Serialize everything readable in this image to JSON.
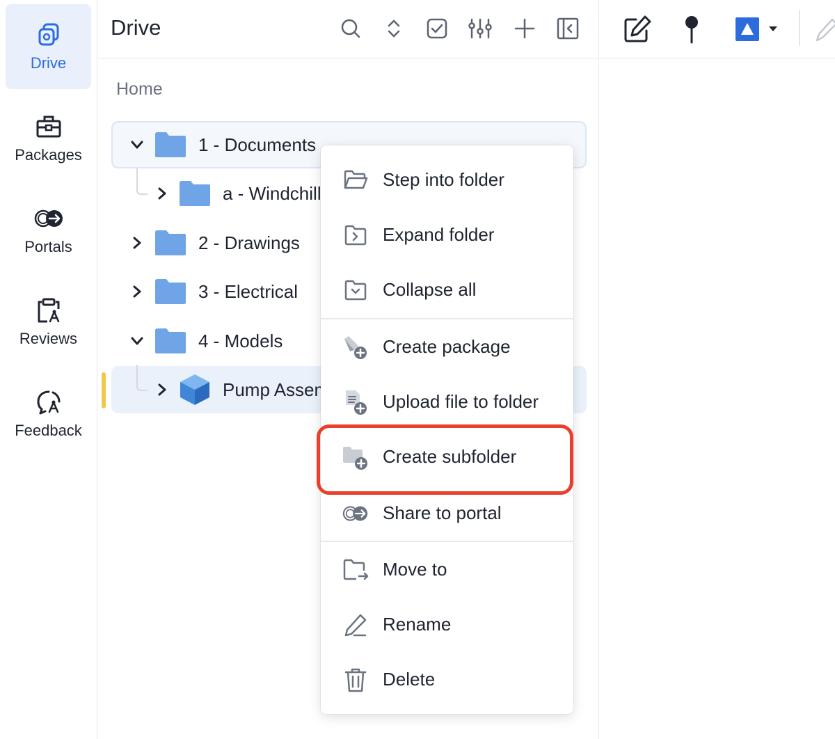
{
  "rail": {
    "items": [
      {
        "label": "Drive",
        "icon": "drive-icon",
        "active": true
      },
      {
        "label": "Packages",
        "icon": "briefcase-icon"
      },
      {
        "label": "Portals",
        "icon": "portal-icon"
      },
      {
        "label": "Reviews",
        "icon": "clipboard-compass-icon"
      },
      {
        "label": "Feedback",
        "icon": "feedback-icon"
      }
    ]
  },
  "panel": {
    "title": "Drive",
    "toolbar": [
      "search-icon",
      "expand-collapse-icon",
      "checkbox-icon",
      "sliders-icon",
      "plus-icon",
      "collapse-panel-icon"
    ],
    "breadcrumb": "Home",
    "tree": [
      {
        "label": "1 - Documents",
        "expanded": true,
        "level": 0,
        "type": "folder"
      },
      {
        "label": "a - Windchill",
        "expanded": false,
        "level": 1,
        "type": "folder"
      },
      {
        "label": "2 - Drawings",
        "expanded": false,
        "level": 0,
        "type": "folder"
      },
      {
        "label": "3 - Electrical",
        "expanded": false,
        "level": 0,
        "type": "folder"
      },
      {
        "label": "4 - Models",
        "expanded": true,
        "level": 0,
        "type": "folder"
      },
      {
        "label": "Pump Assembly",
        "expanded": false,
        "level": 1,
        "type": "assembly"
      }
    ]
  },
  "right_toolbar": [
    "edit-icon",
    "pin-icon",
    "shape-color-picker-icon",
    "pen-icon"
  ],
  "context_menu": {
    "items": [
      {
        "label": "Step into folder",
        "icon": "folder-open-icon"
      },
      {
        "label": "Expand folder",
        "icon": "folder-expand-icon"
      },
      {
        "label": "Collapse all",
        "icon": "folder-collapse-icon"
      },
      {
        "label": "Create package",
        "icon": "create-package-icon"
      },
      {
        "label": "Upload file to folder",
        "icon": "upload-file-icon"
      },
      {
        "label": "Create subfolder",
        "icon": "create-subfolder-icon",
        "highlighted": true
      },
      {
        "label": "Share to portal",
        "icon": "share-portal-icon"
      },
      {
        "label": "Move to",
        "icon": "move-to-icon"
      },
      {
        "label": "Rename",
        "icon": "rename-icon"
      },
      {
        "label": "Delete",
        "icon": "trash-icon"
      }
    ]
  },
  "colors": {
    "accent": "#2d6cdf",
    "folder": "#6fa5e6",
    "highlight_border": "#e8402c",
    "scroll_marker": "#f0c94a"
  }
}
